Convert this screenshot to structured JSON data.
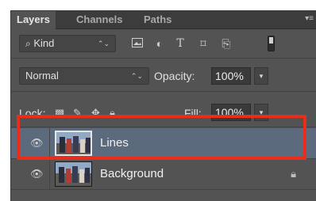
{
  "tabs": [
    {
      "label": "Layers",
      "active": true
    },
    {
      "label": "Channels",
      "active": false
    },
    {
      "label": "Paths",
      "active": false
    }
  ],
  "panel_menu_icon": "panel-menu-icon",
  "filter": {
    "search_icon": "search-icon",
    "kind_label": "Kind",
    "icons": [
      "pixel-filter-icon",
      "adjustment-filter-icon",
      "type-filter-icon",
      "shape-filter-icon",
      "smart-object-filter-icon"
    ]
  },
  "blend": {
    "mode": "Normal",
    "opacity_label": "Opacity:",
    "opacity_value": "100%"
  },
  "lock": {
    "label": "Lock:",
    "icons": [
      "lock-transparent-icon",
      "lock-image-icon",
      "lock-position-icon",
      "lock-all-icon"
    ],
    "fill_label": "Fill:",
    "fill_value": "100%"
  },
  "layers": [
    {
      "name": "Lines",
      "selected": true,
      "visible": true,
      "locked": false
    },
    {
      "name": "Background",
      "selected": false,
      "visible": true,
      "locked": true
    }
  ],
  "colors": {
    "panel": "#535353",
    "selection": "#5b6a7c",
    "annotation": "#ea2c1b"
  }
}
